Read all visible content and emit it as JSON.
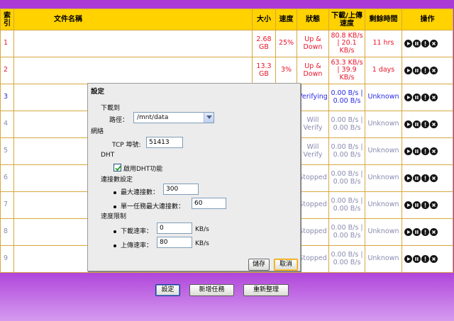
{
  "table": {
    "headers": [
      "索引",
      "文件名稱",
      "大小",
      "速度",
      "狀態",
      "下載/上傳速度",
      "剩餘時間",
      "操作"
    ],
    "rows": [
      {
        "index": "1",
        "name": "",
        "size": "2.68 GB",
        "speed": "25%",
        "status": "Up & Down",
        "rate": "80.8 KB/s | 20.1 KB/s",
        "remaining": "11 hrs"
      },
      {
        "index": "2",
        "name": "",
        "size": "13.3 GB",
        "speed": "3%",
        "status": "Up & Down",
        "rate": "63.3 KB/s | 39.9 KB/s",
        "remaining": "1 days"
      },
      {
        "index": "3",
        "name": "",
        "size": "",
        "speed": "",
        "status": "Verifying",
        "rate": "0.00 B/s | 0.00 B/s",
        "remaining": "Unknown"
      },
      {
        "index": "4",
        "name": "",
        "size": "",
        "speed": "",
        "status": "Will Verify",
        "rate": "0.00 B/s | 0.00 B/s",
        "remaining": "Unknown"
      },
      {
        "index": "5",
        "name": "",
        "size": "",
        "speed": "",
        "status": "Will Verify",
        "rate": "0.00 B/s | 0.00 B/s",
        "remaining": "Unknown"
      },
      {
        "index": "6",
        "name": "",
        "size": "",
        "speed": "",
        "status": "Stopped",
        "rate": "0.00 B/s | 0.00 B/s",
        "remaining": "Unknown"
      },
      {
        "index": "7",
        "name": "",
        "size": "",
        "speed": "",
        "status": "Stopped",
        "rate": "0.00 B/s | 0.00 B/s",
        "remaining": "Unknown"
      },
      {
        "index": "8",
        "name": "",
        "size": "",
        "speed": "",
        "status": "Stopped",
        "rate": "0.00 B/s | 0.00 B/s",
        "remaining": "Unknown"
      },
      {
        "index": "9",
        "name": "",
        "size": "",
        "speed": "",
        "status": "Stopped",
        "rate": "0.00 B/s | 0.00 B/s",
        "remaining": "Unknown"
      }
    ],
    "action_icons": [
      "play-icon",
      "pause-icon",
      "info-icon",
      "close-icon"
    ]
  },
  "dialog": {
    "title": "設定",
    "download_section": "下載到",
    "path_label": "路徑：",
    "path_value": "/mnt/data",
    "network_section": "網絡",
    "tcp_port_label": "TCP 埠號:",
    "tcp_port_value": "51413",
    "dht_section": "DHT",
    "dht_enable_label": "啟用DHT功能",
    "dht_enabled": true,
    "connections_section": "連接數設定",
    "max_conn_label": "最大連接數：",
    "max_conn_value": "300",
    "per_task_conn_label": "單一任務最大連接數：",
    "per_task_conn_value": "60",
    "speed_section": "速度限制",
    "download_rate_label": "下載速率：",
    "download_rate_value": "0",
    "download_rate_unit": "KB/s",
    "upload_rate_label": "上傳速率：",
    "upload_rate_value": "80",
    "upload_rate_unit": "KB/s",
    "save_label": "儲存",
    "cancel_label": "取消"
  },
  "bottom": {
    "settings_label": "設定",
    "new_task_label": "新增任務",
    "refresh_label": "重新整理"
  },
  "colors": {
    "header_bg": "#ffd200",
    "page_bg": "#ad3fd8",
    "red_text": "#e8152a",
    "blue_text": "#2a2ae6",
    "gray_text": "#8a8ab0"
  }
}
